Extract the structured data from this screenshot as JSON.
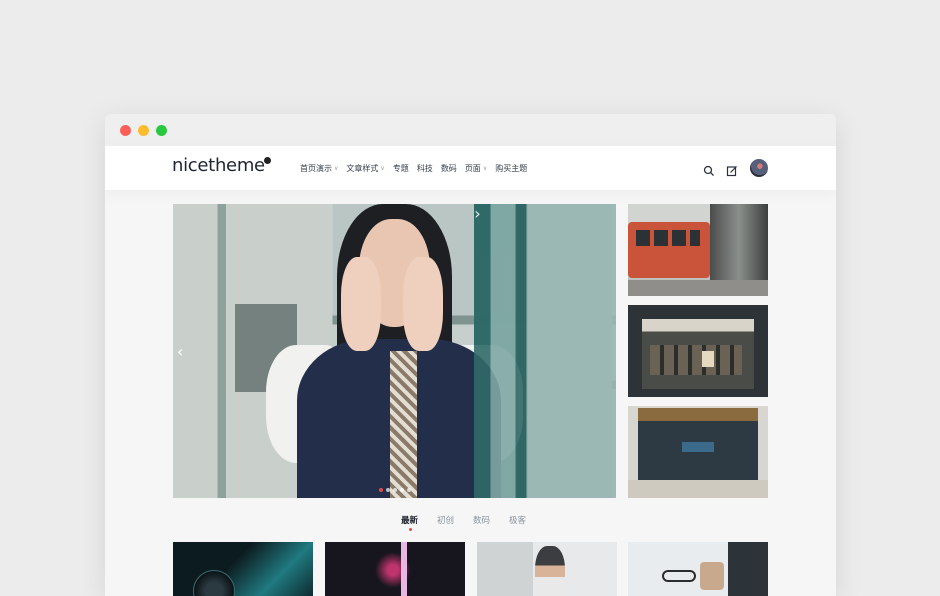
{
  "window": {
    "controls": [
      "close",
      "minimize",
      "maximize"
    ]
  },
  "header": {
    "logo_text": "nicetheme",
    "nav": [
      {
        "label": "首页演示",
        "has_dropdown": true
      },
      {
        "label": "文章样式",
        "has_dropdown": true
      },
      {
        "label": "专题",
        "has_dropdown": false
      },
      {
        "label": "科技",
        "has_dropdown": false
      },
      {
        "label": "数码",
        "has_dropdown": false
      },
      {
        "label": "页面",
        "has_dropdown": true
      },
      {
        "label": "购买主题",
        "has_dropdown": false
      }
    ],
    "icons": [
      "search-icon",
      "edit-icon",
      "avatar"
    ]
  },
  "slider": {
    "prev_symbol": "‹",
    "next_symbol": "›",
    "dot_count": 5,
    "active_dot": 1
  },
  "tabs": [
    {
      "label": "最新",
      "active": true
    },
    {
      "label": "初创",
      "active": false
    },
    {
      "label": "数码",
      "active": false
    },
    {
      "label": "极客",
      "active": false
    }
  ],
  "colors": {
    "accent": "#e34b4b",
    "text_dark": "#1f2430",
    "text_muted": "#8a93a0"
  }
}
